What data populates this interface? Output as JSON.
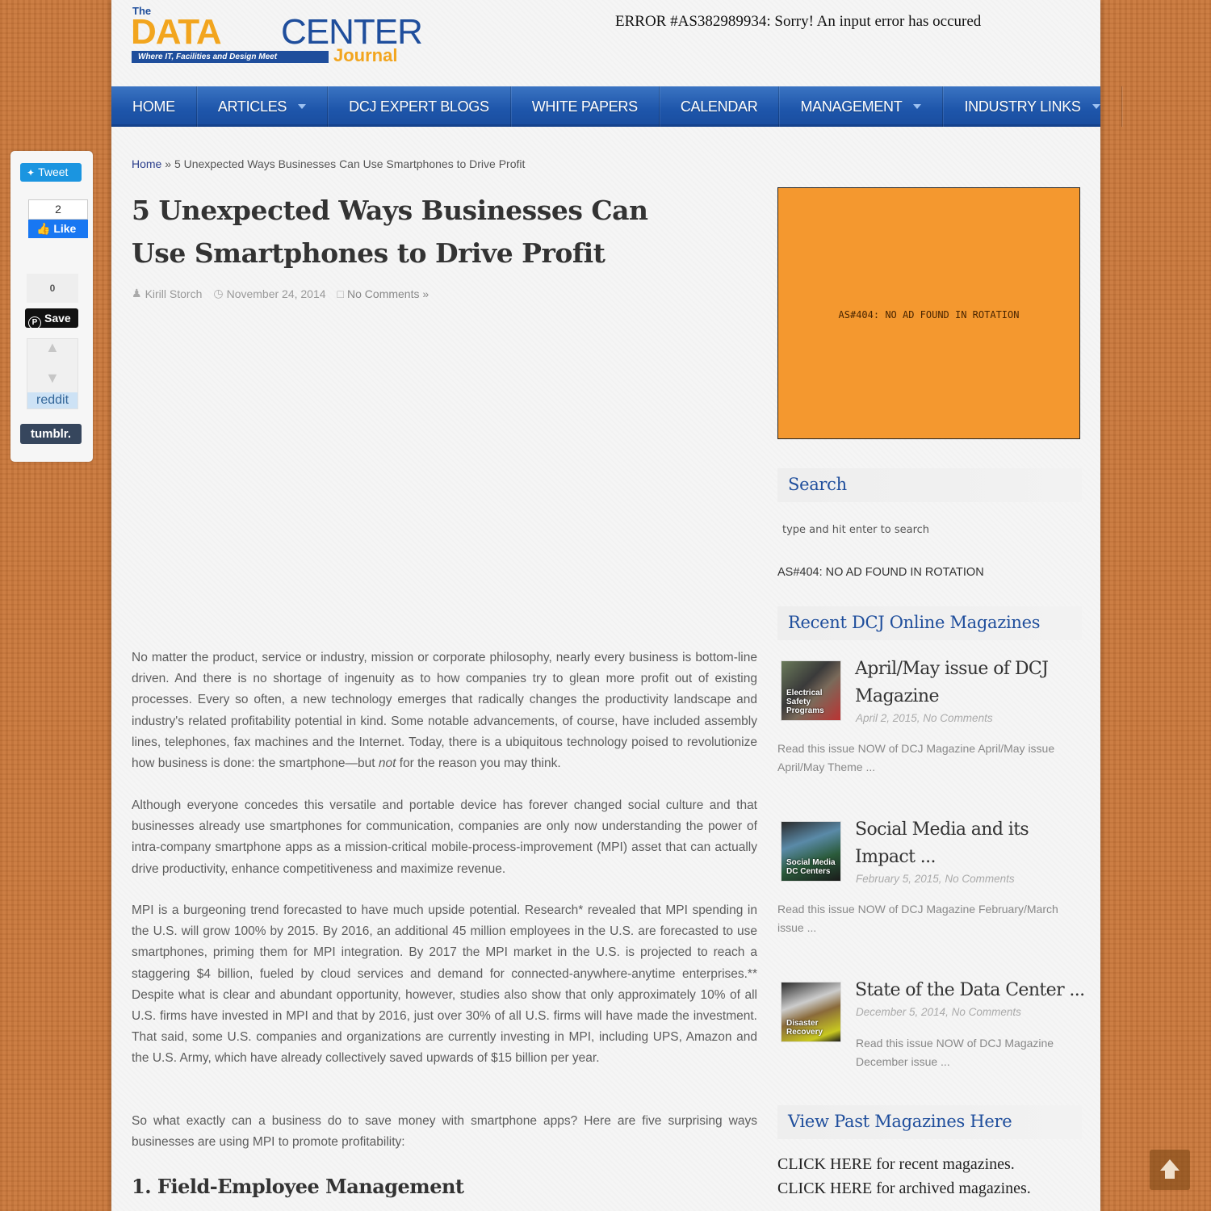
{
  "header": {
    "logo": {
      "the": "The",
      "data": "DATA",
      "center": "CENTER",
      "tagline": "Where IT, Facilities and Design Meet",
      "journal": "Journal"
    },
    "error_message": "ERROR #AS382989934: Sorry! An input error has occured"
  },
  "nav": {
    "items": [
      {
        "label": "HOME",
        "has_dropdown": false
      },
      {
        "label": "ARTICLES",
        "has_dropdown": true
      },
      {
        "label": "DCJ EXPERT BLOGS",
        "has_dropdown": false
      },
      {
        "label": "WHITE PAPERS",
        "has_dropdown": false
      },
      {
        "label": "CALENDAR",
        "has_dropdown": false
      },
      {
        "label": "MANAGEMENT",
        "has_dropdown": true
      },
      {
        "label": "INDUSTRY LINKS",
        "has_dropdown": true
      }
    ]
  },
  "share": {
    "tweet_label": "Tweet",
    "facebook_count": "2",
    "facebook_label": "Like",
    "pinterest_count": "0",
    "pinterest_label": "Save",
    "reddit_label": "reddit",
    "tumblr_label": "tumblr."
  },
  "breadcrumb": {
    "home": "Home",
    "separator": "»",
    "current": "5 Unexpected Ways Businesses Can Use Smartphones to Drive Profit"
  },
  "article": {
    "title": "5 Unexpected Ways Businesses Can Use Smartphones to Drive Profit",
    "author": "Kirill Storch",
    "date": "November 24, 2014",
    "comments": "No Comments »",
    "paragraphs": {
      "p1_before": "No matter the product, service or industry, mission or corporate philosophy, nearly every business is bottom-line driven. And there is no shortage of ingenuity as to how companies try to glean more profit out of existing processes. Every so often, a new technology emerges that radically changes the productivity landscape and industry's related profitability potential in kind. Some notable advancements, of course, have included assembly lines, telephones, fax machines and the Internet. Today, there is a ubiquitous technology poised to revolutionize how business is done: the smartphone—but ",
      "p1_emph": "not",
      "p1_after": " for the reason you may think.",
      "p2": "Although everyone concedes this versatile and portable device has forever changed social culture and that businesses already use smartphones for communication, companies are only now understanding the power of intra-company smartphone apps as a mission-critical mobile-process-improvement (MPI) asset that can actually drive productivity, enhance competitiveness and maximize revenue.",
      "p3": "MPI is a burgeoning trend forecasted to have much upside potential. Research* revealed that MPI spending in the U.S. will grow 100% by 2015. By 2016, an additional 45 million employees in the U.S. are forecasted to use smartphones, priming them for MPI integration. By 2017 the MPI market in the U.S. is projected to reach a staggering $4 billion, fueled by cloud services and demand for connected-anywhere-anytime enterprises.** Despite what is clear and abundant opportunity, however, studies also show that only approximately 10% of all U.S. firms have invested in MPI and that by 2016, just over 30% of all U.S. firms will have made the investment. That said, some U.S. companies and organizations are currently investing in MPI, including UPS, Amazon and the U.S. Army, which have already collectively saved upwards of $15 billion per year.",
      "p4": "So what exactly can a business do to save money with smartphone apps? Here are five surprising ways businesses are using MPI to promote profitability:"
    },
    "section_heading": "1. Field-Employee Management"
  },
  "sidebar": {
    "ad_text": "AS#404: NO AD FOUND IN ROTATION",
    "search": {
      "title": "Search",
      "placeholder": "type and hit enter to search"
    },
    "text_ad": "AS#404: NO AD FOUND IN ROTATION",
    "recent": {
      "title": "Recent DCJ Online Magazines",
      "items": [
        {
          "title": "April/May issue of DCJ Magazine",
          "meta": "April 2, 2015, No Comments",
          "excerpt": "Read this issue NOW of DCJ Magazine April/May issue  April/May Theme ...",
          "thumb_text": "Electrical Safety Programs"
        },
        {
          "title": "Social Media and its Impact ...",
          "meta": "February 5, 2015, No Comments",
          "excerpt": "Read this issue NOW of DCJ Magazine February/March issue    ...",
          "thumb_text": "Social Media DC Centers"
        },
        {
          "title": "State of the Data Center ...",
          "meta": "December 5, 2014, No Comments",
          "excerpt": "Read this issue NOW of DCJ Magazine December issue     ...",
          "thumb_text": "Disaster Recovery"
        }
      ]
    },
    "past": {
      "title": "View Past Magazines Here",
      "link_recent": "CLICK HERE for recent magazines.",
      "link_archived": "CLICK HERE for archived magazines."
    }
  },
  "colors": {
    "brand_blue": "#1f4e9c",
    "brand_orange": "#f2a51e",
    "ad_orange": "#f4982f",
    "background_wood": "#c9773a"
  }
}
